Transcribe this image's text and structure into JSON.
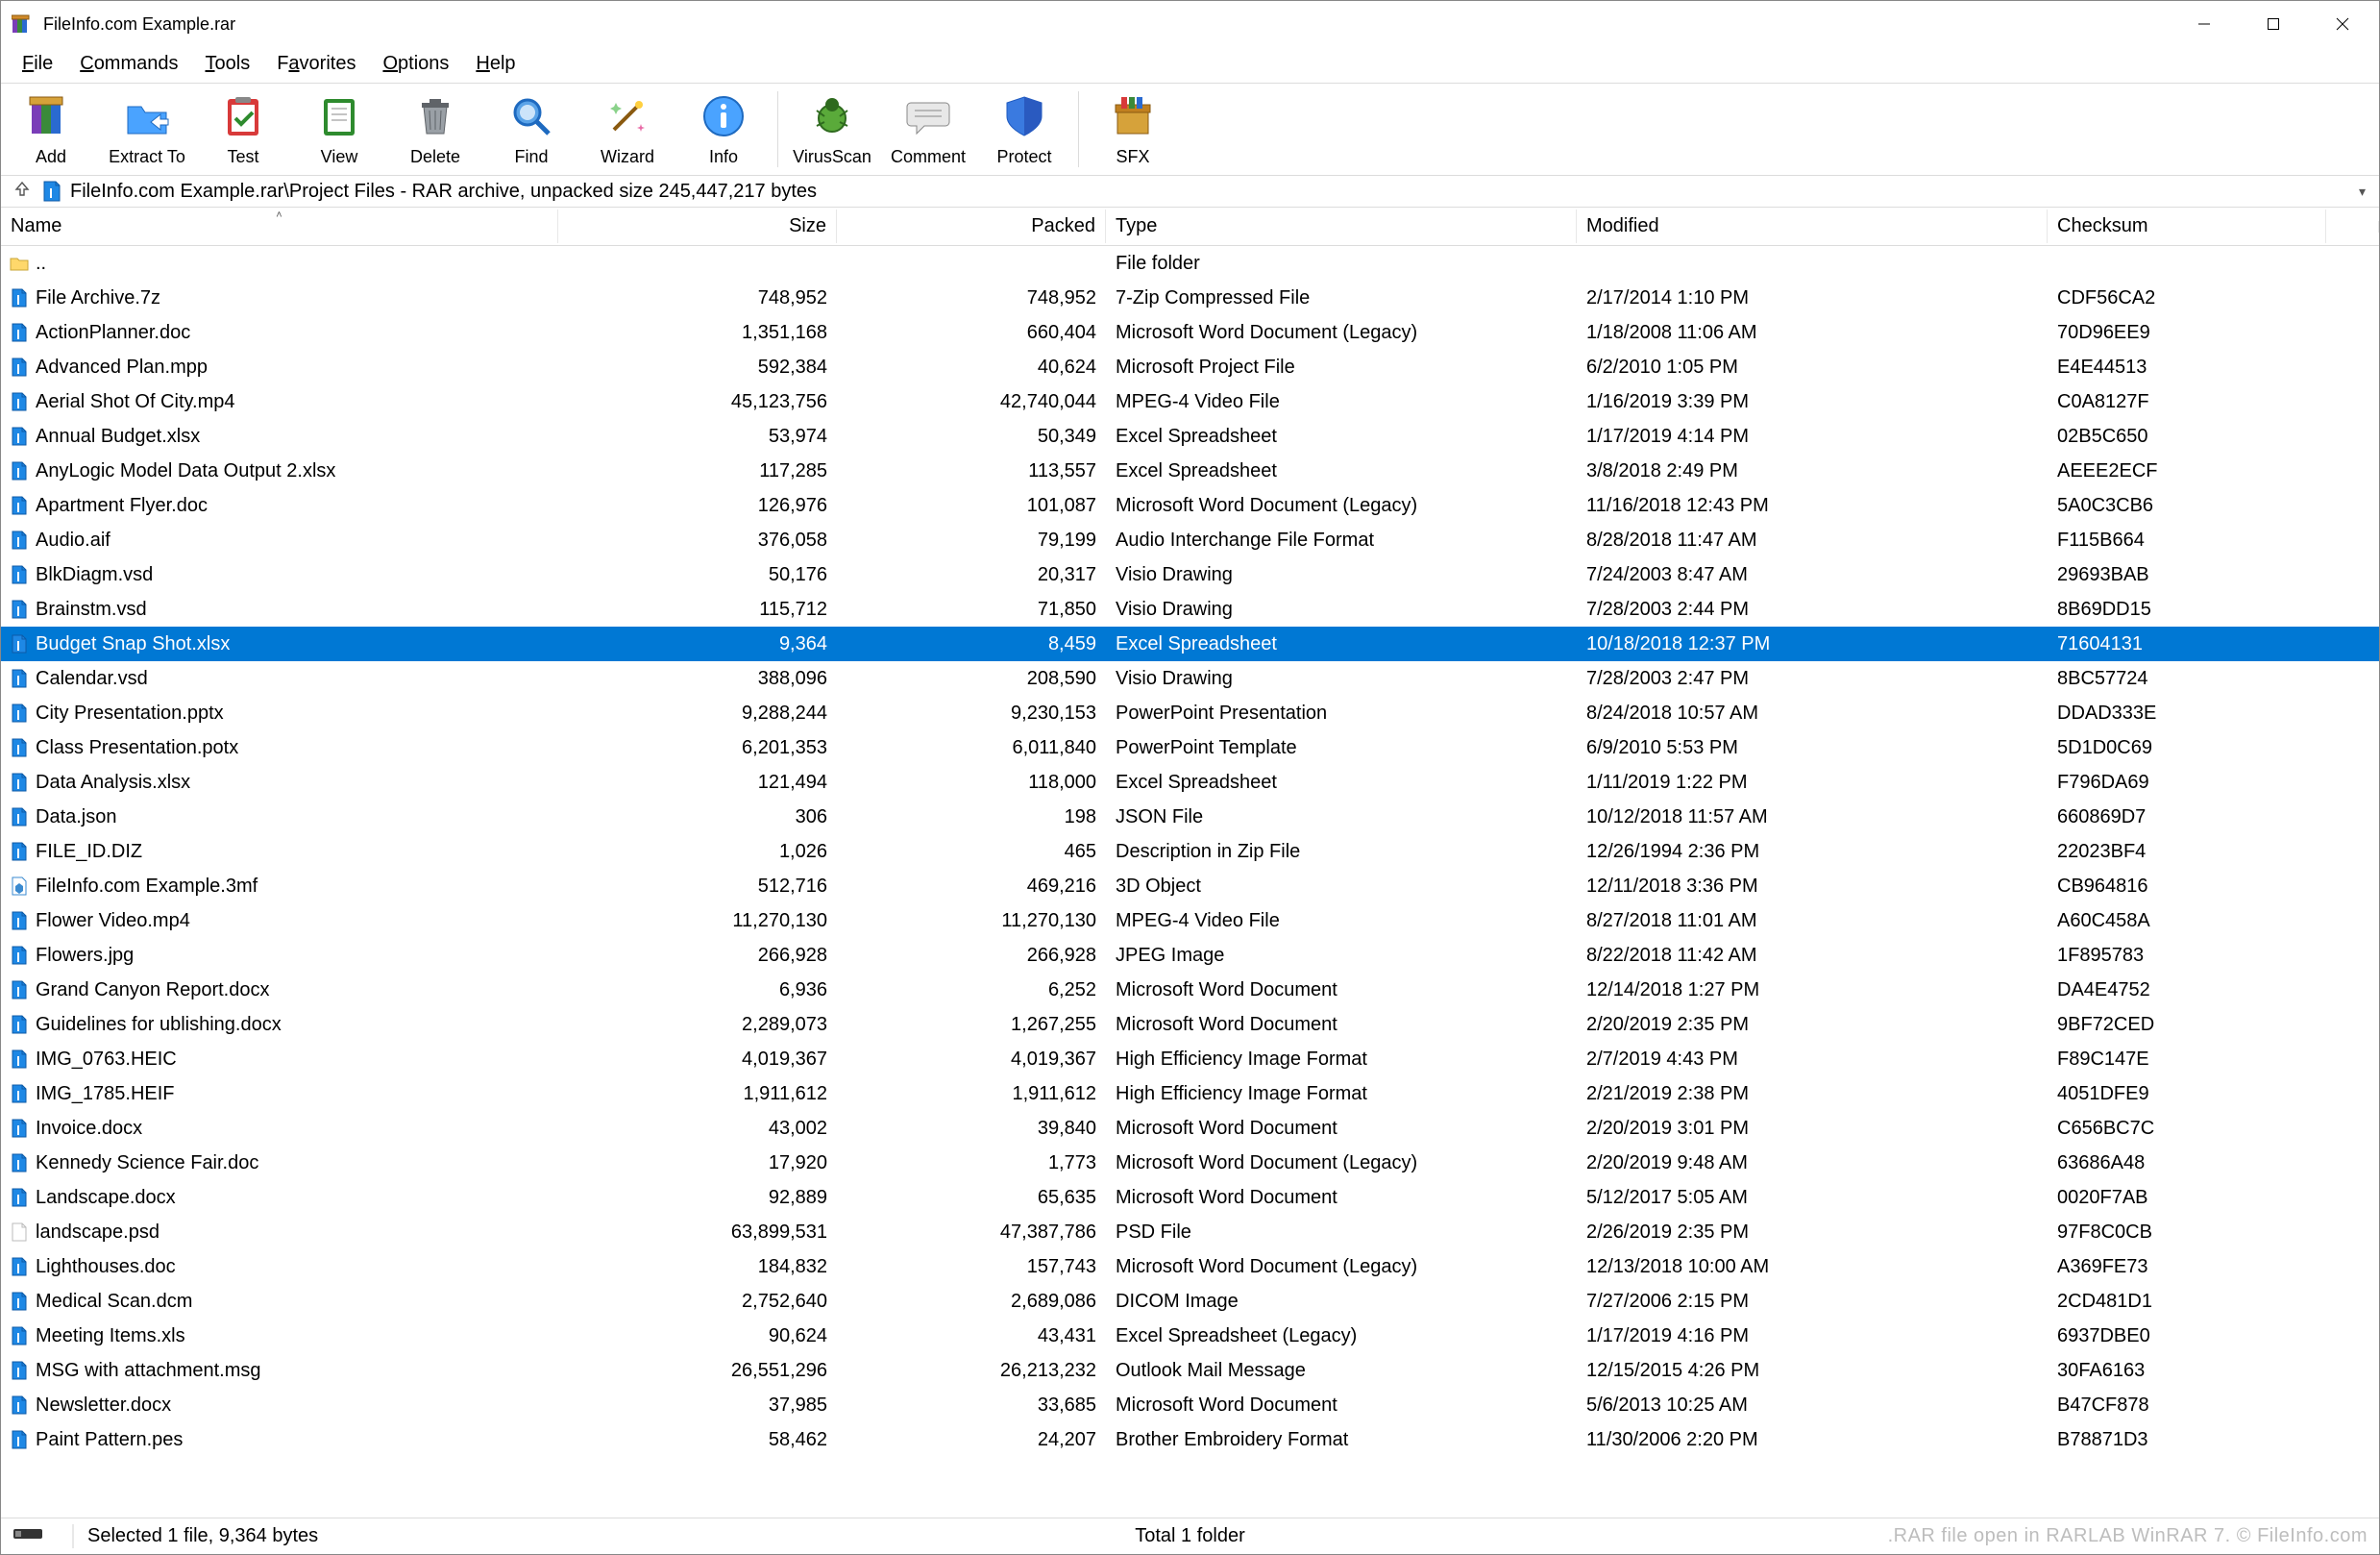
{
  "window": {
    "title": "FileInfo.com Example.rar"
  },
  "menu": [
    {
      "label": "File",
      "u": 0
    },
    {
      "label": "Commands",
      "u": 0
    },
    {
      "label": "Tools",
      "u": 0
    },
    {
      "label": "Favorites",
      "u": 1
    },
    {
      "label": "Options",
      "u": 0
    },
    {
      "label": "Help",
      "u": 0
    }
  ],
  "toolbar": [
    {
      "key": "add",
      "label": "Add",
      "icon": "books"
    },
    {
      "key": "extract-to",
      "label": "Extract To",
      "icon": "folder-out"
    },
    {
      "key": "test",
      "label": "Test",
      "icon": "clipboard-check"
    },
    {
      "key": "view",
      "label": "View",
      "icon": "notebook"
    },
    {
      "key": "delete",
      "label": "Delete",
      "icon": "trash"
    },
    {
      "key": "find",
      "label": "Find",
      "icon": "magnifier"
    },
    {
      "key": "wizard",
      "label": "Wizard",
      "icon": "wand"
    },
    {
      "key": "info",
      "label": "Info",
      "icon": "info"
    },
    {
      "key": "virus-scan",
      "label": "VirusScan",
      "icon": "bug",
      "after_divider": true
    },
    {
      "key": "comment",
      "label": "Comment",
      "icon": "chat"
    },
    {
      "key": "protect",
      "label": "Protect",
      "icon": "shield"
    },
    {
      "key": "sfx",
      "label": "SFX",
      "icon": "box",
      "after_divider": true
    }
  ],
  "path": {
    "text": "FileInfo.com Example.rar\\Project Files - RAR archive, unpacked size 245,447,217 bytes"
  },
  "columns": [
    {
      "key": "name",
      "label": "Name",
      "align": "left",
      "sort": "asc"
    },
    {
      "key": "size",
      "label": "Size",
      "align": "right"
    },
    {
      "key": "packed",
      "label": "Packed",
      "align": "right"
    },
    {
      "key": "type",
      "label": "Type",
      "align": "left"
    },
    {
      "key": "modified",
      "label": "Modified",
      "align": "left"
    },
    {
      "key": "checksum",
      "label": "Checksum",
      "align": "left"
    }
  ],
  "parent_row": {
    "name": "..",
    "type": "File folder",
    "icon": "folder"
  },
  "rows": [
    {
      "icon": "arch",
      "name": "File Archive.7z",
      "size": "748,952",
      "packed": "748,952",
      "type": "7-Zip Compressed File",
      "modified": "2/17/2014 1:10 PM",
      "checksum": "CDF56CA2"
    },
    {
      "icon": "arch",
      "name": "ActionPlanner.doc",
      "size": "1,351,168",
      "packed": "660,404",
      "type": "Microsoft Word Document (Legacy)",
      "modified": "1/18/2008 11:06 AM",
      "checksum": "70D96EE9"
    },
    {
      "icon": "arch",
      "name": "Advanced Plan.mpp",
      "size": "592,384",
      "packed": "40,624",
      "type": "Microsoft Project File",
      "modified": "6/2/2010 1:05 PM",
      "checksum": "E4E44513"
    },
    {
      "icon": "arch",
      "name": "Aerial Shot Of City.mp4",
      "size": "45,123,756",
      "packed": "42,740,044",
      "type": "MPEG-4 Video File",
      "modified": "1/16/2019 3:39 PM",
      "checksum": "C0A8127F"
    },
    {
      "icon": "arch",
      "name": "Annual Budget.xlsx",
      "size": "53,974",
      "packed": "50,349",
      "type": "Excel Spreadsheet",
      "modified": "1/17/2019 4:14 PM",
      "checksum": "02B5C650"
    },
    {
      "icon": "arch",
      "name": "AnyLogic Model Data Output 2.xlsx",
      "size": "117,285",
      "packed": "113,557",
      "type": "Excel Spreadsheet",
      "modified": "3/8/2018 2:49 PM",
      "checksum": "AEEE2ECF"
    },
    {
      "icon": "arch",
      "name": "Apartment Flyer.doc",
      "size": "126,976",
      "packed": "101,087",
      "type": "Microsoft Word Document (Legacy)",
      "modified": "11/16/2018 12:43 PM",
      "checksum": "5A0C3CB6"
    },
    {
      "icon": "arch",
      "name": "Audio.aif",
      "size": "376,058",
      "packed": "79,199",
      "type": "Audio Interchange File Format",
      "modified": "8/28/2018 11:47 AM",
      "checksum": "F115B664"
    },
    {
      "icon": "arch",
      "name": "BlkDiagm.vsd",
      "size": "50,176",
      "packed": "20,317",
      "type": "Visio Drawing",
      "modified": "7/24/2003 8:47 AM",
      "checksum": "29693BAB"
    },
    {
      "icon": "arch",
      "name": "Brainstm.vsd",
      "size": "115,712",
      "packed": "71,850",
      "type": "Visio Drawing",
      "modified": "7/28/2003 2:44 PM",
      "checksum": "8B69DD15"
    },
    {
      "icon": "arch",
      "name": "Budget Snap Shot.xlsx",
      "size": "9,364",
      "packed": "8,459",
      "type": "Excel Spreadsheet",
      "modified": "10/18/2018 12:37 PM",
      "checksum": "71604131",
      "selected": true
    },
    {
      "icon": "arch",
      "name": "Calendar.vsd",
      "size": "388,096",
      "packed": "208,590",
      "type": "Visio Drawing",
      "modified": "7/28/2003 2:47 PM",
      "checksum": "8BC57724"
    },
    {
      "icon": "arch",
      "name": "City Presentation.pptx",
      "size": "9,288,244",
      "packed": "9,230,153",
      "type": "PowerPoint Presentation",
      "modified": "8/24/2018 10:57 AM",
      "checksum": "DDAD333E"
    },
    {
      "icon": "arch",
      "name": "Class Presentation.potx",
      "size": "6,201,353",
      "packed": "6,011,840",
      "type": "PowerPoint Template",
      "modified": "6/9/2010 5:53 PM",
      "checksum": "5D1D0C69"
    },
    {
      "icon": "arch",
      "name": "Data Analysis.xlsx",
      "size": "121,494",
      "packed": "118,000",
      "type": "Excel Spreadsheet",
      "modified": "1/11/2019 1:22 PM",
      "checksum": "F796DA69"
    },
    {
      "icon": "arch",
      "name": "Data.json",
      "size": "306",
      "packed": "198",
      "type": "JSON File",
      "modified": "10/12/2018 11:57 AM",
      "checksum": "660869D7"
    },
    {
      "icon": "arch",
      "name": "FILE_ID.DIZ",
      "size": "1,026",
      "packed": "465",
      "type": "Description in Zip File",
      "modified": "12/26/1994 2:36 PM",
      "checksum": "22023BF4"
    },
    {
      "icon": "3mf",
      "name": "FileInfo.com Example.3mf",
      "size": "512,716",
      "packed": "469,216",
      "type": "3D Object",
      "modified": "12/11/2018 3:36 PM",
      "checksum": "CB964816"
    },
    {
      "icon": "arch",
      "name": "Flower Video.mp4",
      "size": "11,270,130",
      "packed": "11,270,130",
      "type": "MPEG-4 Video File",
      "modified": "8/27/2018 11:01 AM",
      "checksum": "A60C458A"
    },
    {
      "icon": "arch",
      "name": "Flowers.jpg",
      "size": "266,928",
      "packed": "266,928",
      "type": "JPEG Image",
      "modified": "8/22/2018 11:42 AM",
      "checksum": "1F895783"
    },
    {
      "icon": "arch",
      "name": "Grand Canyon Report.docx",
      "size": "6,936",
      "packed": "6,252",
      "type": "Microsoft Word Document",
      "modified": "12/14/2018 1:27 PM",
      "checksum": "DA4E4752"
    },
    {
      "icon": "arch",
      "name": "Guidelines for ublishing.docx",
      "size": "2,289,073",
      "packed": "1,267,255",
      "type": "Microsoft Word Document",
      "modified": "2/20/2019 2:35 PM",
      "checksum": "9BF72CED"
    },
    {
      "icon": "arch",
      "name": "IMG_0763.HEIC",
      "size": "4,019,367",
      "packed": "4,019,367",
      "type": "High Efficiency Image Format",
      "modified": "2/7/2019 4:43 PM",
      "checksum": "F89C147E"
    },
    {
      "icon": "arch",
      "name": "IMG_1785.HEIF",
      "size": "1,911,612",
      "packed": "1,911,612",
      "type": "High Efficiency Image Format",
      "modified": "2/21/2019 2:38 PM",
      "checksum": "4051DFE9"
    },
    {
      "icon": "arch",
      "name": "Invoice.docx",
      "size": "43,002",
      "packed": "39,840",
      "type": "Microsoft Word Document",
      "modified": "2/20/2019 3:01 PM",
      "checksum": "C656BC7C"
    },
    {
      "icon": "arch",
      "name": "Kennedy Science Fair.doc",
      "size": "17,920",
      "packed": "1,773",
      "type": "Microsoft Word Document (Legacy)",
      "modified": "2/20/2019 9:48 AM",
      "checksum": "63686A48"
    },
    {
      "icon": "arch",
      "name": "Landscape.docx",
      "size": "92,889",
      "packed": "65,635",
      "type": "Microsoft Word Document",
      "modified": "5/12/2017 5:05 AM",
      "checksum": "0020F7AB"
    },
    {
      "icon": "blank",
      "name": "landscape.psd",
      "size": "63,899,531",
      "packed": "47,387,786",
      "type": "PSD File",
      "modified": "2/26/2019 2:35 PM",
      "checksum": "97F8C0CB"
    },
    {
      "icon": "arch",
      "name": "Lighthouses.doc",
      "size": "184,832",
      "packed": "157,743",
      "type": "Microsoft Word Document (Legacy)",
      "modified": "12/13/2018 10:00 AM",
      "checksum": "A369FE73"
    },
    {
      "icon": "arch",
      "name": "Medical Scan.dcm",
      "size": "2,752,640",
      "packed": "2,689,086",
      "type": "DICOM Image",
      "modified": "7/27/2006 2:15 PM",
      "checksum": "2CD481D1"
    },
    {
      "icon": "arch",
      "name": "Meeting Items.xls",
      "size": "90,624",
      "packed": "43,431",
      "type": "Excel Spreadsheet (Legacy)",
      "modified": "1/17/2019 4:16 PM",
      "checksum": "6937DBE0"
    },
    {
      "icon": "arch",
      "name": "MSG with attachment.msg",
      "size": "26,551,296",
      "packed": "26,213,232",
      "type": "Outlook Mail Message",
      "modified": "12/15/2015 4:26 PM",
      "checksum": "30FA6163"
    },
    {
      "icon": "arch",
      "name": "Newsletter.docx",
      "size": "37,985",
      "packed": "33,685",
      "type": "Microsoft Word Document",
      "modified": "5/6/2013 10:25 AM",
      "checksum": "B47CF878"
    },
    {
      "icon": "arch",
      "name": "Paint Pattern.pes",
      "size": "58,462",
      "packed": "24,207",
      "type": "Brother Embroidery Format",
      "modified": "11/30/2006 2:20 PM",
      "checksum": "B78871D3"
    }
  ],
  "status": {
    "selected": "Selected 1 file, 9,364 bytes",
    "total": "Total 1 folder",
    "watermark": ".RAR file open in RARLAB WinRAR 7.  © FileInfo.com"
  }
}
